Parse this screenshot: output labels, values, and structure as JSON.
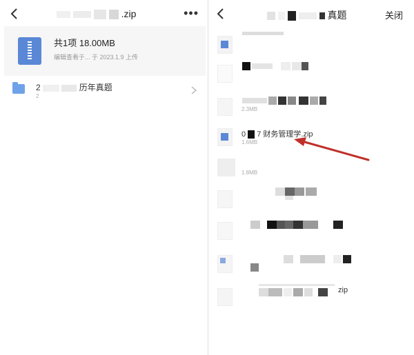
{
  "left_panel": {
    "title_suffix": ".zip",
    "more_label": "•••",
    "summary": {
      "count_label": "共1项 18.00MB",
      "meta_label": "编辑查看于... 于 2023.1.9 上传"
    },
    "folder": {
      "name_prefix": "2",
      "name_suffix": "历年真题",
      "sub_label": "2"
    }
  },
  "right_panel": {
    "title_suffix": "真题",
    "close_label": "关闭",
    "items": [
      {
        "name": "",
        "size": ""
      },
      {
        "name": "",
        "size": ""
      },
      {
        "name": "",
        "size": "2.3MB"
      },
      {
        "name_prefix": "0",
        "name_suffix": "7 财务管理学.zip",
        "size": "1.6MB"
      },
      {
        "name": "",
        "size": "1.8MB"
      },
      {
        "name": "",
        "size": ""
      },
      {
        "name": "",
        "size": ""
      },
      {
        "name": "",
        "size": ""
      },
      {
        "name_suffix": "zip",
        "size": ""
      }
    ]
  },
  "colors": {
    "accent": "#5b88d6",
    "annotation_arrow": "#c0302a",
    "card_bg": "#f6f6f6"
  }
}
